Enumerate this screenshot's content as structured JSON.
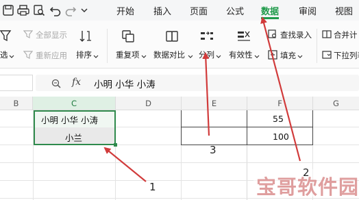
{
  "toolbar": {
    "tabs": [
      {
        "label": "开始"
      },
      {
        "label": "插入"
      },
      {
        "label": "页面"
      },
      {
        "label": "公式"
      },
      {
        "label": "数据",
        "active": true
      },
      {
        "label": "审阅"
      },
      {
        "label": "视图"
      }
    ]
  },
  "ribbon": {
    "show_all": "全部显示",
    "reapply": "重新应用",
    "filter_tail": "选",
    "sort": "排序",
    "duplicates": "重复项",
    "compare": "数据对比",
    "split": "分列",
    "validity": "有效性",
    "fill": "填充",
    "find_entry": "查找录入",
    "merge_calc": "合并计",
    "dropdown_list": "下拉列表"
  },
  "formula_bar": {
    "fx_label": "fx",
    "content": "小明  小华  小涛"
  },
  "sheet": {
    "columns": [
      "B",
      "C",
      "D",
      "E",
      "F",
      "G"
    ],
    "selected_column": "C",
    "rows": [
      {
        "C": "小明  小华  小涛",
        "F": "55"
      },
      {
        "C": "小兰",
        "F": "100"
      }
    ]
  },
  "annotations": {
    "labels": [
      "1",
      "2",
      "3"
    ],
    "arrow_color": "#d13b3b"
  },
  "watermark": "宝哥软件园"
}
